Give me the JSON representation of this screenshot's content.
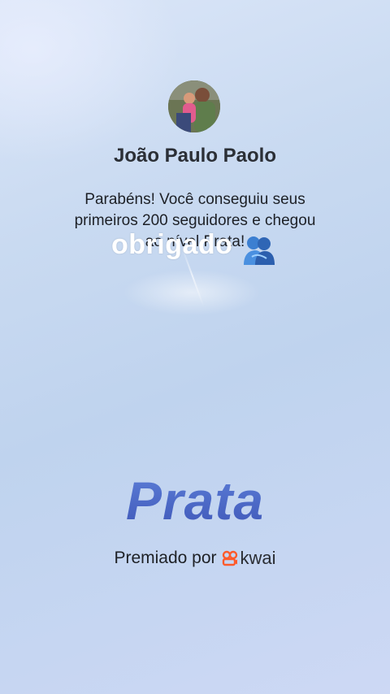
{
  "profile": {
    "name": "João Paulo Paolo"
  },
  "message": {
    "line1": "Parabéns! Você conseguiu seus",
    "line2": "primeiros 200 seguidores e chegou",
    "line3": "ao nível Prata!"
  },
  "overlay": {
    "text": "obrigado",
    "icon": "people-hugging-icon"
  },
  "tier": {
    "label": "Prata",
    "color": "#4a68c4"
  },
  "award": {
    "prefix": "Premiado por",
    "brand": "kwai",
    "brand_icon": "kwai-logo-icon",
    "brand_color": "#ff5a2a"
  }
}
